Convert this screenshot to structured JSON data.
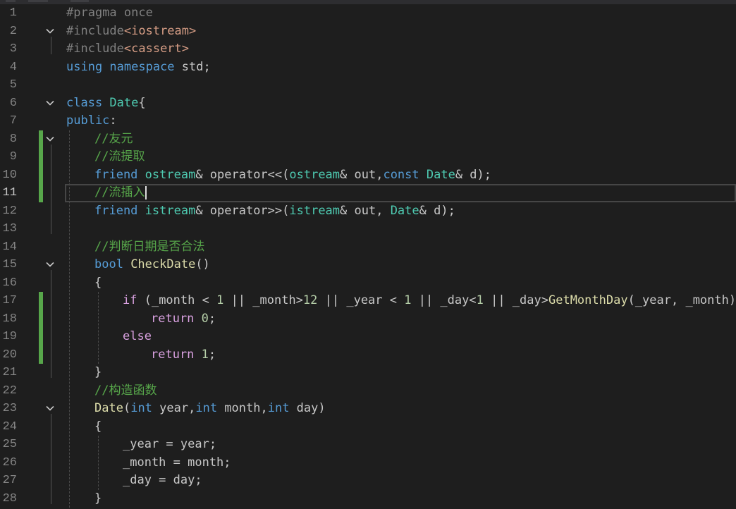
{
  "editor": {
    "current_line": 11,
    "lines": [
      {
        "n": "1",
        "fold": false,
        "indent": 0,
        "tokens": [
          {
            "c": "p",
            "t": "#pragma once"
          }
        ]
      },
      {
        "n": "2",
        "fold": true,
        "indent": 0,
        "tokens": [
          {
            "c": "p",
            "t": "#include"
          },
          {
            "c": "s",
            "t": "<iostream>"
          }
        ]
      },
      {
        "n": "3",
        "fold": false,
        "indent": 0,
        "tokens": [
          {
            "c": "p",
            "t": "#include"
          },
          {
            "c": "s",
            "t": "<cassert>"
          }
        ]
      },
      {
        "n": "4",
        "fold": false,
        "indent": 0,
        "tokens": [
          {
            "c": "k",
            "t": "using namespace"
          },
          {
            "c": "g",
            "t": " std;"
          }
        ]
      },
      {
        "n": "5",
        "fold": false,
        "indent": 0,
        "tokens": []
      },
      {
        "n": "6",
        "fold": true,
        "indent": 0,
        "tokens": [
          {
            "c": "k",
            "t": "class "
          },
          {
            "c": "t",
            "t": "Date"
          },
          {
            "c": "g",
            "t": "{"
          }
        ]
      },
      {
        "n": "7",
        "fold": false,
        "indent": 0,
        "tokens": [
          {
            "c": "k",
            "t": "public"
          },
          {
            "c": "g",
            "t": ":"
          }
        ]
      },
      {
        "n": "8",
        "fold": true,
        "indent": 1,
        "tokens": [
          {
            "c": "c",
            "t": "//友元"
          }
        ]
      },
      {
        "n": "9",
        "fold": false,
        "indent": 1,
        "tokens": [
          {
            "c": "c",
            "t": "//流提取"
          }
        ]
      },
      {
        "n": "10",
        "fold": false,
        "indent": 1,
        "tokens": [
          {
            "c": "k",
            "t": "friend "
          },
          {
            "c": "t",
            "t": "ostream"
          },
          {
            "c": "g",
            "t": "& operator<<("
          },
          {
            "c": "t",
            "t": "ostream"
          },
          {
            "c": "g",
            "t": "& out,"
          },
          {
            "c": "k",
            "t": "const "
          },
          {
            "c": "t",
            "t": "Date"
          },
          {
            "c": "g",
            "t": "& d);"
          }
        ]
      },
      {
        "n": "11",
        "fold": false,
        "indent": 1,
        "tokens": [
          {
            "c": "c",
            "t": "//流插入"
          }
        ]
      },
      {
        "n": "12",
        "fold": false,
        "indent": 1,
        "tokens": [
          {
            "c": "k",
            "t": "friend "
          },
          {
            "c": "t",
            "t": "istream"
          },
          {
            "c": "g",
            "t": "& operator>>("
          },
          {
            "c": "t",
            "t": "istream"
          },
          {
            "c": "g",
            "t": "& out, "
          },
          {
            "c": "t",
            "t": "Date"
          },
          {
            "c": "g",
            "t": "& d);"
          }
        ]
      },
      {
        "n": "13",
        "fold": false,
        "indent": 1,
        "tokens": []
      },
      {
        "n": "14",
        "fold": false,
        "indent": 1,
        "tokens": [
          {
            "c": "c",
            "t": "//判断日期是否合法"
          }
        ]
      },
      {
        "n": "15",
        "fold": true,
        "indent": 1,
        "tokens": [
          {
            "c": "k",
            "t": "bool "
          },
          {
            "c": "f",
            "t": "CheckDate"
          },
          {
            "c": "g",
            "t": "()"
          }
        ]
      },
      {
        "n": "16",
        "fold": false,
        "indent": 1,
        "tokens": [
          {
            "c": "g",
            "t": "{"
          }
        ]
      },
      {
        "n": "17",
        "fold": false,
        "indent": 2,
        "tokens": [
          {
            "c": "m",
            "t": "if"
          },
          {
            "c": "g",
            "t": " (_month < "
          },
          {
            "c": "n",
            "t": "1"
          },
          {
            "c": "g",
            "t": " || _month>"
          },
          {
            "c": "n",
            "t": "12"
          },
          {
            "c": "g",
            "t": " || _year < "
          },
          {
            "c": "n",
            "t": "1"
          },
          {
            "c": "g",
            "t": " || _day<"
          },
          {
            "c": "n",
            "t": "1"
          },
          {
            "c": "g",
            "t": " || _day>"
          },
          {
            "c": "f",
            "t": "GetMonthDay"
          },
          {
            "c": "g",
            "t": "(_year, _month))"
          }
        ]
      },
      {
        "n": "18",
        "fold": false,
        "indent": 3,
        "tokens": [
          {
            "c": "m",
            "t": "return "
          },
          {
            "c": "n",
            "t": "0"
          },
          {
            "c": "g",
            "t": ";"
          }
        ]
      },
      {
        "n": "19",
        "fold": false,
        "indent": 2,
        "tokens": [
          {
            "c": "m",
            "t": "else"
          }
        ]
      },
      {
        "n": "20",
        "fold": false,
        "indent": 3,
        "tokens": [
          {
            "c": "m",
            "t": "return "
          },
          {
            "c": "n",
            "t": "1"
          },
          {
            "c": "g",
            "t": ";"
          }
        ]
      },
      {
        "n": "21",
        "fold": false,
        "indent": 1,
        "tokens": [
          {
            "c": "g",
            "t": "}"
          }
        ]
      },
      {
        "n": "22",
        "fold": false,
        "indent": 1,
        "tokens": [
          {
            "c": "c",
            "t": "//构造函数"
          }
        ]
      },
      {
        "n": "23",
        "fold": true,
        "indent": 1,
        "tokens": [
          {
            "c": "f",
            "t": "Date"
          },
          {
            "c": "g",
            "t": "("
          },
          {
            "c": "k",
            "t": "int "
          },
          {
            "c": "g",
            "t": "year,"
          },
          {
            "c": "k",
            "t": "int "
          },
          {
            "c": "g",
            "t": "month,"
          },
          {
            "c": "k",
            "t": "int "
          },
          {
            "c": "g",
            "t": "day)"
          }
        ]
      },
      {
        "n": "24",
        "fold": false,
        "indent": 1,
        "tokens": [
          {
            "c": "g",
            "t": "{"
          }
        ]
      },
      {
        "n": "25",
        "fold": false,
        "indent": 2,
        "tokens": [
          {
            "c": "g",
            "t": "_year = year;"
          }
        ]
      },
      {
        "n": "26",
        "fold": false,
        "indent": 2,
        "tokens": [
          {
            "c": "g",
            "t": "_month = month;"
          }
        ]
      },
      {
        "n": "27",
        "fold": false,
        "indent": 2,
        "tokens": [
          {
            "c": "g",
            "t": "_day = day;"
          }
        ]
      },
      {
        "n": "28",
        "fold": false,
        "indent": 1,
        "tokens": [
          {
            "c": "g",
            "t": "}"
          }
        ]
      }
    ],
    "change_markers": [
      [
        8,
        11
      ],
      [
        17,
        20
      ]
    ],
    "colors": {
      "background": "#1e1e1e",
      "line_number": "#858585",
      "keyword": "#569cd6",
      "type": "#4ec9b0",
      "function": "#dcdcaa",
      "comment": "#57a64a",
      "include_path": "#d69d85",
      "preprocessor": "#808080",
      "control": "#d8a0df",
      "number": "#b5cea8",
      "text": "#c8c8c8",
      "change_bar": "#57a64a"
    }
  }
}
